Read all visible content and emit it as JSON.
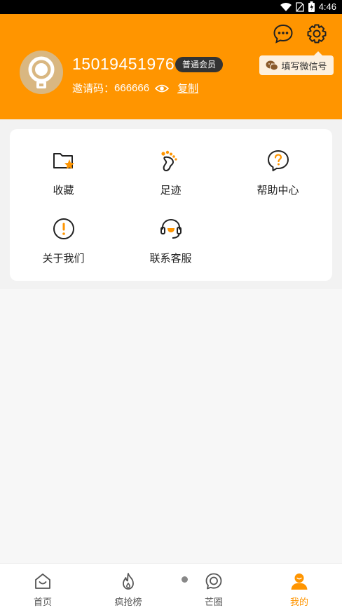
{
  "status_bar": {
    "time": "4:46"
  },
  "profile": {
    "phone": "15019451976",
    "member_badge": "普通会员",
    "invite_label": "邀请码：",
    "invite_code": "666666",
    "copy_label": "复制",
    "wechat_tip": "填写微信号"
  },
  "menu": {
    "items": [
      {
        "label": "收藏",
        "icon": "favorites-folder-icon"
      },
      {
        "label": "足迹",
        "icon": "footprint-icon"
      },
      {
        "label": "帮助中心",
        "icon": "help-icon"
      },
      {
        "label": "关于我们",
        "icon": "info-icon"
      },
      {
        "label": "联系客服",
        "icon": "customer-service-icon"
      }
    ]
  },
  "tabbar": {
    "tabs": [
      {
        "label": "首页",
        "icon": "home-icon"
      },
      {
        "label": "疯抢榜",
        "icon": "flame-icon"
      },
      {
        "label": "芒圈",
        "icon": "chat-circle-icon"
      },
      {
        "label": "我的",
        "icon": "profile-icon",
        "active": true
      }
    ]
  },
  "colors": {
    "accent": "#ff9500",
    "badge_bg": "#333333",
    "tip_bg": "#fdf0de"
  }
}
